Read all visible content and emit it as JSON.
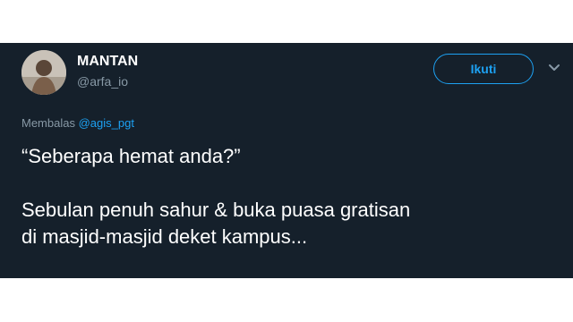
{
  "tweet": {
    "display_name": "MANTAN",
    "handle": "@arfa_io",
    "follow_label": "Ikuti",
    "reply_prefix": "Membalas",
    "reply_mention": "@agis_pgt",
    "text": "“Seberapa hemat anda?”\n\nSebulan penuh sahur & buka puasa gratisan\ndi masjid-masjid deket kampus...",
    "icons": [
      "avatar",
      "chevron-down-icon"
    ]
  },
  "colors": {
    "background": "#15202b",
    "accent": "#1da1f2",
    "secondary_text": "#8899a6",
    "primary_text": "#ffffff"
  }
}
